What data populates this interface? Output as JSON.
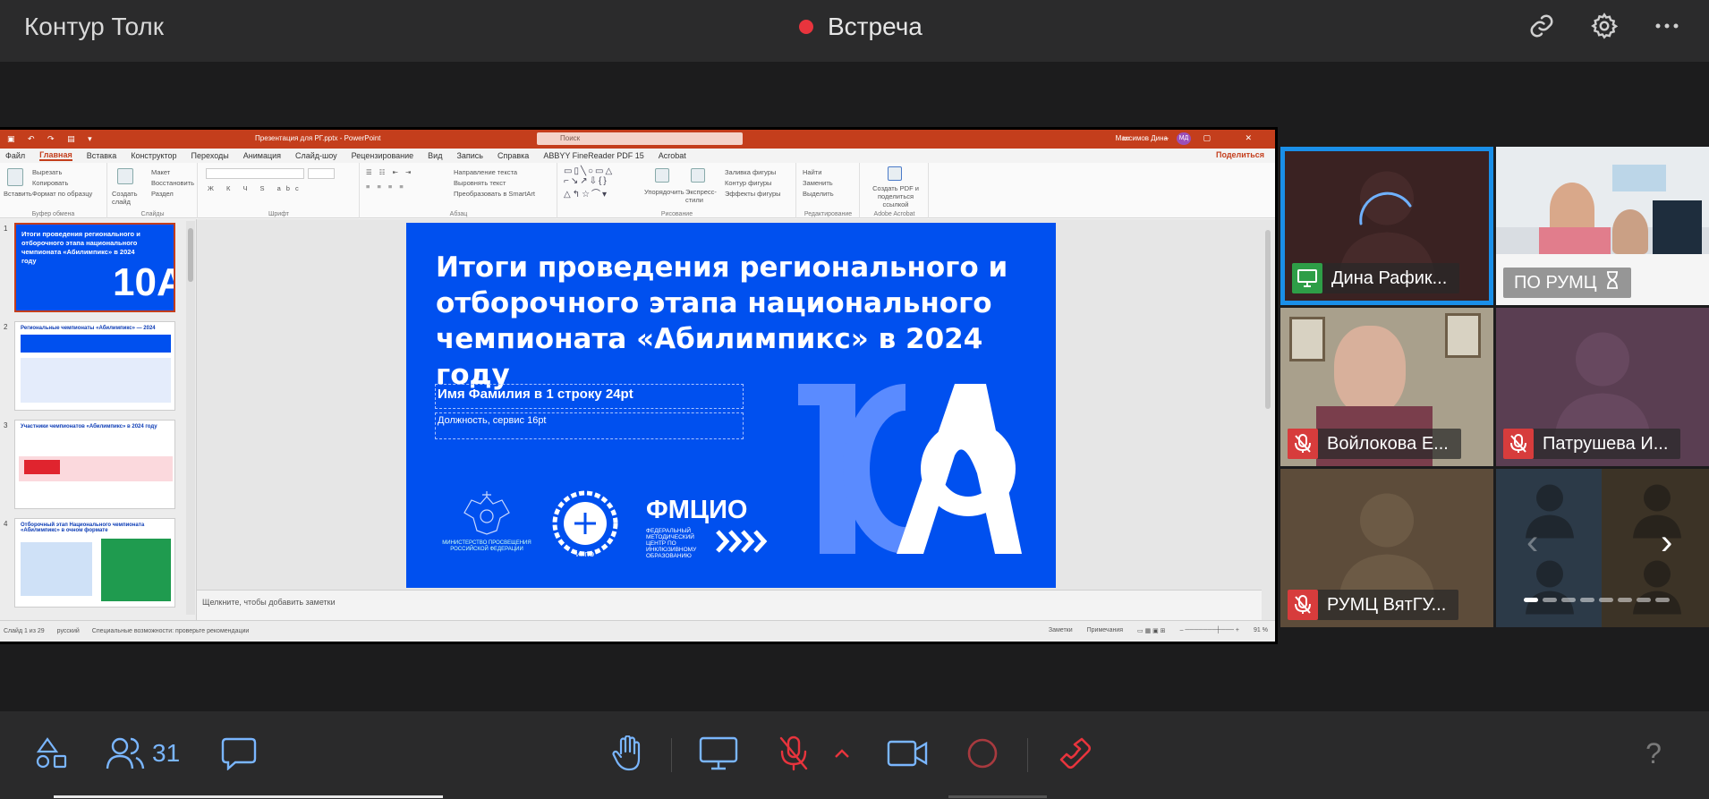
{
  "header": {
    "app_title": "Контур Толк",
    "meeting_title": "Встреча",
    "icons": [
      "link-icon",
      "gear-icon",
      "more-icon"
    ]
  },
  "powerpoint": {
    "file_title": "Презентация для РГ.pptx  -  PowerPoint",
    "search_placeholder": "Поиск",
    "user_name": "Максимов Дина",
    "user_initials": "МД",
    "share_label": "Поделиться",
    "tabs": [
      "Файл",
      "Главная",
      "Вставка",
      "Конструктор",
      "Переходы",
      "Анимация",
      "Слайд-шоу",
      "Рецензирование",
      "Вид",
      "Запись",
      "Справка",
      "ABBYY FineReader PDF 15",
      "Acrobat"
    ],
    "ribbon": {
      "clipboard": {
        "paste": "Вставить",
        "cut": "Вырезать",
        "copy": "Копировать",
        "format_painter": "Формат по образцу",
        "label": "Буфер обмена"
      },
      "slides": {
        "new_slide": "Создать слайд",
        "layout": "Макет",
        "reset": "Восстановить",
        "section": "Раздел",
        "label": "Слайды"
      },
      "font": {
        "label": "Шрифт"
      },
      "paragraph": {
        "text_direction": "Направление текста",
        "align_text": "Выровнять текст",
        "smartart": "Преобразовать в SmartArt",
        "label": "Абзац"
      },
      "drawing": {
        "arrange": "Упорядочить",
        "quick_styles": "Экспресс-стили",
        "shape_fill": "Заливка фигуры",
        "shape_outline": "Контур фигуры",
        "shape_effects": "Эффекты фигуры",
        "label": "Рисование"
      },
      "editing": {
        "find": "Найти",
        "replace": "Заменить",
        "select": "Выделить",
        "label": "Редактирование"
      },
      "acrobat": {
        "create_pdf": "Создать PDF и поделиться ссылкой",
        "label": "Adobe Acrobat"
      }
    },
    "thumbnails": [
      {
        "num": "1",
        "title": "Итоги проведения регионального и отборочного этапа национального чемпионата «Абилимпикс» в 2024 году"
      },
      {
        "num": "2",
        "title": "Региональные чемпионаты «Абилимпикс» — 2024"
      },
      {
        "num": "3",
        "title": "Участники чемпионатов «Абилимпикс» в 2024 году"
      },
      {
        "num": "4",
        "title": "Отборочный этап Национального чемпионата «Абилимпикс» в очном формате"
      }
    ],
    "slide": {
      "title": "Итоги проведения регионального и отборочного этапа национального чемпионата «Абилимпикс» в 2024 году",
      "name_placeholder": "Имя Фамилия в 1 строку 24pt",
      "position_placeholder": "Должность, сервис 16pt",
      "ministry_text": "МИНИСТЕРСТВО ПРОСВЕЩЕНИЯ РОССИЙСКОЙ ФЕДЕРАЦИИ",
      "irpo_text": "ИРПО",
      "fmcio_title": "ФМЦИО",
      "fmcio_text": "ФЕДЕРАЛЬНЫЙ МЕТОДИЧЕСКИЙ ЦЕНТР ПО ИНКЛЮЗИВНОМУ ОБРАЗОВАНИЮ",
      "big_logo": "10A",
      "bg_color": "#0050ef"
    },
    "notes_placeholder": "Щелкните, чтобы добавить заметки",
    "status": {
      "slide_of": "Слайд 1 из 29",
      "language": "русский",
      "accessibility": "Специальные возможности: проверьте рекомендации",
      "notes_btn": "Заметки",
      "comments_btn": "Примечания",
      "zoom": "91 %"
    }
  },
  "participants": [
    {
      "name": "Дина Рафик...",
      "status": "screen-share",
      "active": true
    },
    {
      "name": "ПО РУМЦ",
      "status": "hourglass",
      "active": false
    },
    {
      "name": "Войлокова Е...",
      "status": "muted",
      "active": false
    },
    {
      "name": "Патрушева И...",
      "status": "muted",
      "active": false
    },
    {
      "name": "РУМЦ ВятГУ...",
      "status": "muted",
      "active": false
    }
  ],
  "pager": {
    "pages": 8,
    "current": 1
  },
  "bottom": {
    "participants_count": "31",
    "help_label": "?",
    "colors": {
      "accent": "#7ab6ff",
      "danger": "#e8343d",
      "muted": "#d73c3c"
    }
  }
}
